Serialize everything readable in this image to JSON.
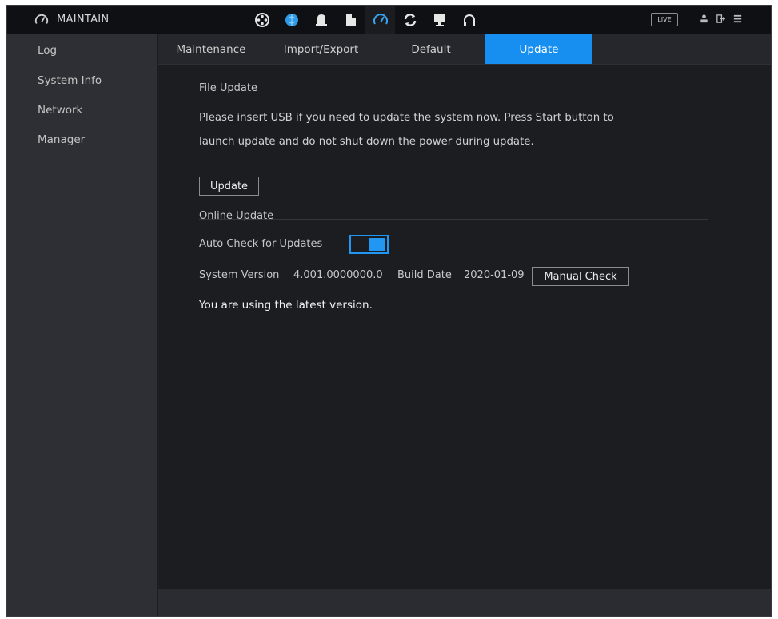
{
  "header": {
    "title": "MAINTAIN",
    "live_label": "LIVE",
    "menu_icons": [
      "playback-reel-icon",
      "ai-brain-icon",
      "alarm-bell-icon",
      "storage-icon",
      "maintain-gauge-icon",
      "backup-sync-icon",
      "display-monitor-icon",
      "audio-headset-icon"
    ],
    "right_icons": [
      "user-icon",
      "logout-icon",
      "grid-menu-icon"
    ],
    "accent_color": "#168ff0"
  },
  "sidebar": {
    "items": [
      {
        "label": "Log"
      },
      {
        "label": "System Info"
      },
      {
        "label": "Network"
      },
      {
        "label": "Manager"
      }
    ]
  },
  "tabs": {
    "items": [
      {
        "label": "Maintenance"
      },
      {
        "label": "Import/Export"
      },
      {
        "label": "Default"
      },
      {
        "label": "Update",
        "active": true
      }
    ]
  },
  "file_update": {
    "heading": "File Update",
    "line1": "Please insert USB if you need to update the system now. Press Start button to",
    "line2": "launch update and do not shut down the power during update.",
    "button_label": "Update"
  },
  "online_update": {
    "heading": "Online Update",
    "auto_check_label": "Auto Check for Updates",
    "auto_check_enabled": true,
    "system_version_label": "System Version",
    "system_version_value": "4.001.0000000.0",
    "build_date_label": "Build Date",
    "build_date_value": "2020-01-09",
    "manual_check_label": "Manual Check",
    "status_message": "You are using the latest version."
  }
}
